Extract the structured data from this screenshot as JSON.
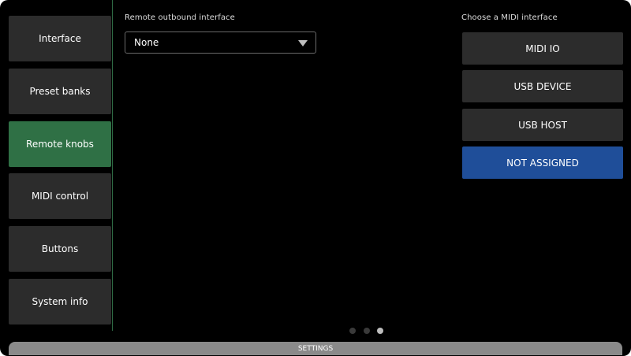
{
  "sidebar": {
    "items": [
      {
        "label": "Interface"
      },
      {
        "label": "Preset banks"
      },
      {
        "label": "Remote knobs",
        "active": true
      },
      {
        "label": "MIDI control"
      },
      {
        "label": "Buttons"
      },
      {
        "label": "System info"
      }
    ]
  },
  "outbound": {
    "label": "Remote outbound interface",
    "value": "None",
    "icon": "chevron-down-icon"
  },
  "midi": {
    "label": "Choose a MIDI interface",
    "options": [
      {
        "label": "MIDI IO"
      },
      {
        "label": "USB DEVICE"
      },
      {
        "label": "USB HOST"
      },
      {
        "label": "NOT ASSIGNED",
        "selected": true
      }
    ]
  },
  "pager": {
    "page": 3,
    "total": 3
  },
  "bottom_bar": {
    "label": "SETTINGS"
  },
  "colors": {
    "active_menu": "#2f7045",
    "selected_option": "#1f4e99",
    "button_bg": "#2c2c2c",
    "background": "#000000"
  }
}
